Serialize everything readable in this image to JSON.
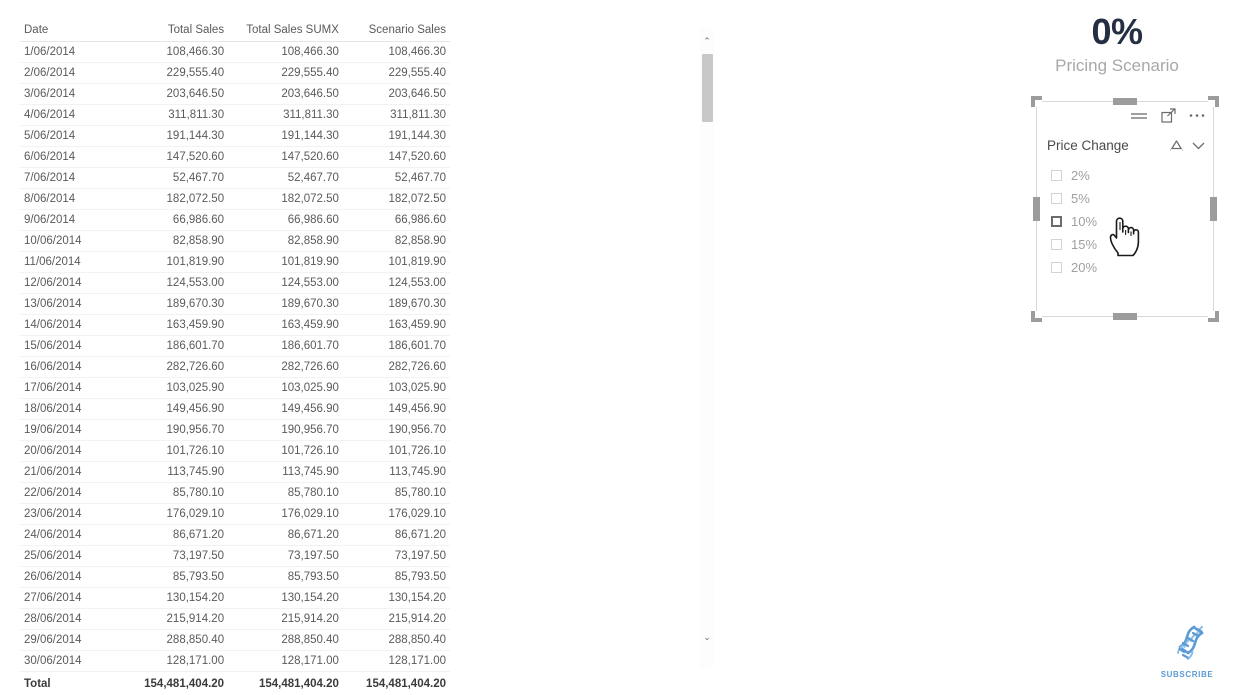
{
  "table": {
    "columns": [
      "Date",
      "Total Sales",
      "Total Sales SUMX",
      "Scenario Sales"
    ],
    "rows": [
      [
        "1/06/2014",
        "108,466.30",
        "108,466.30",
        "108,466.30"
      ],
      [
        "2/06/2014",
        "229,555.40",
        "229,555.40",
        "229,555.40"
      ],
      [
        "3/06/2014",
        "203,646.50",
        "203,646.50",
        "203,646.50"
      ],
      [
        "4/06/2014",
        "311,811.30",
        "311,811.30",
        "311,811.30"
      ],
      [
        "5/06/2014",
        "191,144.30",
        "191,144.30",
        "191,144.30"
      ],
      [
        "6/06/2014",
        "147,520.60",
        "147,520.60",
        "147,520.60"
      ],
      [
        "7/06/2014",
        "52,467.70",
        "52,467.70",
        "52,467.70"
      ],
      [
        "8/06/2014",
        "182,072.50",
        "182,072.50",
        "182,072.50"
      ],
      [
        "9/06/2014",
        "66,986.60",
        "66,986.60",
        "66,986.60"
      ],
      [
        "10/06/2014",
        "82,858.90",
        "82,858.90",
        "82,858.90"
      ],
      [
        "11/06/2014",
        "101,819.90",
        "101,819.90",
        "101,819.90"
      ],
      [
        "12/06/2014",
        "124,553.00",
        "124,553.00",
        "124,553.00"
      ],
      [
        "13/06/2014",
        "189,670.30",
        "189,670.30",
        "189,670.30"
      ],
      [
        "14/06/2014",
        "163,459.90",
        "163,459.90",
        "163,459.90"
      ],
      [
        "15/06/2014",
        "186,601.70",
        "186,601.70",
        "186,601.70"
      ],
      [
        "16/06/2014",
        "282,726.60",
        "282,726.60",
        "282,726.60"
      ],
      [
        "17/06/2014",
        "103,025.90",
        "103,025.90",
        "103,025.90"
      ],
      [
        "18/06/2014",
        "149,456.90",
        "149,456.90",
        "149,456.90"
      ],
      [
        "19/06/2014",
        "190,956.70",
        "190,956.70",
        "190,956.70"
      ],
      [
        "20/06/2014",
        "101,726.10",
        "101,726.10",
        "101,726.10"
      ],
      [
        "21/06/2014",
        "113,745.90",
        "113,745.90",
        "113,745.90"
      ],
      [
        "22/06/2014",
        "85,780.10",
        "85,780.10",
        "85,780.10"
      ],
      [
        "23/06/2014",
        "176,029.10",
        "176,029.10",
        "176,029.10"
      ],
      [
        "24/06/2014",
        "86,671.20",
        "86,671.20",
        "86,671.20"
      ],
      [
        "25/06/2014",
        "73,197.50",
        "73,197.50",
        "73,197.50"
      ],
      [
        "26/06/2014",
        "85,793.50",
        "85,793.50",
        "85,793.50"
      ],
      [
        "27/06/2014",
        "130,154.20",
        "130,154.20",
        "130,154.20"
      ],
      [
        "28/06/2014",
        "215,914.20",
        "215,914.20",
        "215,914.20"
      ],
      [
        "29/06/2014",
        "288,850.40",
        "288,850.40",
        "288,850.40"
      ],
      [
        "30/06/2014",
        "128,171.00",
        "128,171.00",
        "128,171.00"
      ]
    ],
    "total_row": [
      "Total",
      "154,481,404.20",
      "154,481,404.20",
      "154,481,404.20"
    ]
  },
  "kpi": {
    "value": "0%",
    "label": "Pricing Scenario",
    "value_color": "#252f43",
    "label_color": "#a8a8a8"
  },
  "slicer": {
    "title": "Price Change",
    "header_icons": [
      "filter-icon",
      "focus-mode-icon",
      "more-options-icon"
    ],
    "title_icons": [
      "eraser-clear-icon",
      "chevron-down-icon"
    ],
    "items": [
      {
        "label": "2%",
        "checked": false,
        "hovered": false
      },
      {
        "label": "5%",
        "checked": false,
        "hovered": false
      },
      {
        "label": "10%",
        "checked": false,
        "hovered": true
      },
      {
        "label": "15%",
        "checked": false,
        "hovered": false
      },
      {
        "label": "20%",
        "checked": false,
        "hovered": false
      }
    ]
  },
  "watermark": {
    "text": "SUBSCRIBE",
    "color": "#5b9bd5"
  },
  "scrollbar": {
    "up_arrow": "⌃",
    "down_arrow": "⌄"
  }
}
